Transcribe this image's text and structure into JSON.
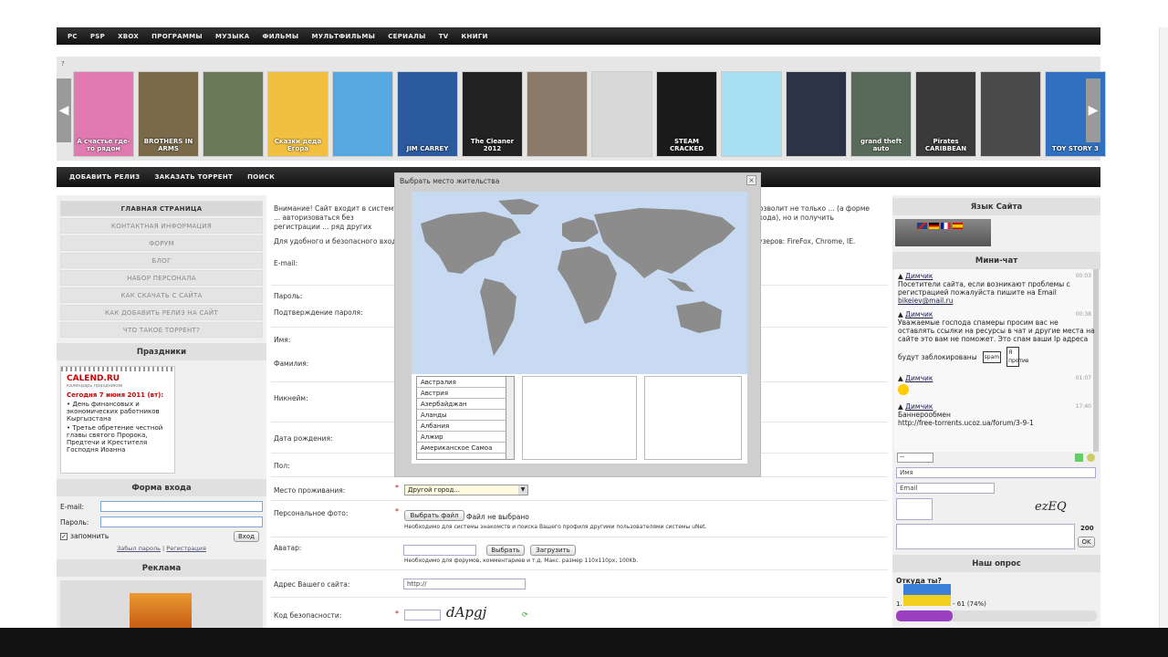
{
  "top_nav": [
    "PC",
    "PSP",
    "XBOX",
    "ПРОГРАММЫ",
    "МУЗЫКА",
    "ФИЛЬМЫ",
    "МУЛЬТФИЛЬМЫ",
    "СЕРИАЛЫ",
    "TV",
    "КНИГИ"
  ],
  "banner": {
    "help_mark": "?",
    "covers": [
      {
        "label": "А счастье где-то рядом",
        "color": "#e07ab0"
      },
      {
        "label": "BROTHERS IN ARMS",
        "color": "#7a6a4a"
      },
      {
        "label": "",
        "color": "#6b7b5a"
      },
      {
        "label": "Сказки деда Егора",
        "color": "#f2c040"
      },
      {
        "label": "",
        "color": "#55a8e0"
      },
      {
        "label": "JIM CARREY",
        "color": "#2c5a9e"
      },
      {
        "label": "The Cleaner 2012",
        "color": "#222222"
      },
      {
        "label": "",
        "color": "#8a7a6a"
      },
      {
        "label": "",
        "color": "#d8d8d8"
      },
      {
        "label": "STEAM CRACKED",
        "color": "#1a1a1a"
      },
      {
        "label": "",
        "color": "#a8dff2"
      },
      {
        "label": "",
        "color": "#2a3444"
      },
      {
        "label": "grand theft auto",
        "color": "#5a6a5a"
      },
      {
        "label": "Pirates CARIBBEAN",
        "color": "#3a3a3a"
      },
      {
        "label": "",
        "color": "#4a4a4a"
      },
      {
        "label": "TOY STORY 3",
        "color": "#3070c0"
      }
    ]
  },
  "second_nav": [
    "ДОБАВИТЬ РЕЛИЗ",
    "ЗАКАЗАТЬ ТОРРЕНТ",
    "ПОИСК"
  ],
  "left_menu": [
    "ГЛАВНАЯ СТРАНИЦА",
    "КОНТАКТНАЯ ИНФОРМАЦИЯ",
    "ФОРУМ",
    "БЛОГ",
    "НАБОР ПЕРСОНАЛА",
    "КАК СКАЧАТЬ С САЙТА",
    "КАК ДОБАВИТЬ РЕЛИЗ НА САЙТ",
    "ЧТО ТАКОЕ ТОРРЕНТ?"
  ],
  "holidays": {
    "title": "Праздники",
    "logo": "CALEND.RU",
    "logo_sub": "календарь праздников",
    "date": "Сегодня 7 июня 2011 (вт):",
    "items": [
      "День финансовых и экономических работников Кыргызстана",
      "Третье обретение честной главы святого Пророка, Предтечи и Крестителя Господня Иоанна"
    ]
  },
  "login": {
    "title": "Форма входа",
    "email_label": "E-mail:",
    "password_label": "Пароль:",
    "remember": "запомнить",
    "login_btn": "Вход",
    "forgot": "Забыл пароль",
    "register": "Регистрация"
  },
  "ads_title": "Реклама",
  "main": {
    "notice": "Внимание! Сайт входит в систему ... авторизоваться без регистрации ... ряд других возможностей.",
    "notice_right": "позволит не только ... (а форме входа), но и получить",
    "browser_note": "Для удобного и безопасного вход",
    "browser_note_right": "узеров: FireFox, Chrome, IE.",
    "labels": {
      "email": "E-mail:",
      "password": "Пароль:",
      "confirm": "Подтверждение пароля:",
      "name": "Имя:",
      "surname": "Фамилия:",
      "nickname": "Никнейм:",
      "birthdate": "Дата рождения:",
      "gender": "Пол:",
      "residence": "Место проживания:",
      "photo": "Персональное фото:",
      "avatar": "Аватар:",
      "website": "Адрес Вашего сайта:",
      "captcha": "Код безопасности:"
    },
    "residence_value": "Другой город...",
    "choose_file": "Выбрать файл",
    "no_file": "Файл не выбрано",
    "photo_hint": "Необходимо для системы знакомств и поиска Вашего профиля другими пользователями системы uNet.",
    "avatar_choose": "Выбрать",
    "avatar_upload": "Загрузить",
    "avatar_hint": "Необходимо для форумов, комментариев и т.д. Макс. размер 110x110px, 100Kb.",
    "website_value": "http://",
    "captcha_text": "dApgj"
  },
  "overlay": {
    "title": "Выбрать место жительства",
    "close": "×",
    "countries": [
      "Австралия",
      "Австрия",
      "Азербайджан",
      "Аланды",
      "Албания",
      "Алжир",
      "Американское Самоа"
    ]
  },
  "right": {
    "lang_title": "Язык Сайта",
    "chat_title": "Мини-чат",
    "messages": [
      {
        "name": "Димчик",
        "time": "00:03",
        "text": "Посетители сайта, если возникают проблемы с регистрацией пожалуйста пишите на Email",
        "link": "bikeiev@mail.ru"
      },
      {
        "name": "Димчик",
        "time": "00:38",
        "text": "Уважаемые господа спамеры просим вас не оставлять ссылки на ресурсы в чат и другие места на сайте это вам не поможет. Это спам ваши Ip адреса",
        "extra": "будут заблокированы",
        "sign1": "spam",
        "sign2": "Я против"
      },
      {
        "name": "Димчик",
        "time": "01:07",
        "text": ""
      },
      {
        "name": "Димчик",
        "time": "17:40",
        "text": "Баннерообмен",
        "link": "http://free-torrents.ucoz.ua/forum/3-9-1"
      }
    ],
    "select_value": "--",
    "name_placeholder": "Имя",
    "email_placeholder": "Email",
    "captcha_text": "ezEQ",
    "counter": "200",
    "ok": "OK",
    "poll_title": "Наш опрос",
    "poll_question": "Откуда ты?",
    "poll_result_prefix": "1.",
    "poll_result": "- 61 (74%)",
    "poll_percent": 74
  }
}
